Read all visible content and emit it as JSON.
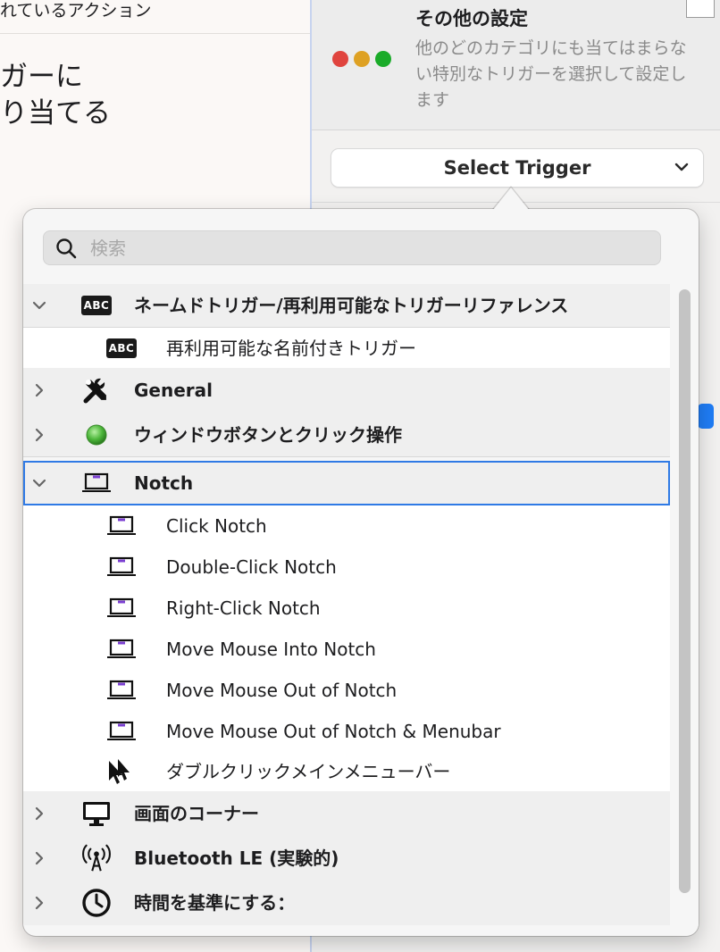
{
  "background": {
    "left_header": "れているアクション",
    "left_big_line1": "ガーに",
    "left_big_line2": "り当てる",
    "other_title": "その他の設定",
    "other_desc": "他のどのカテゴリにも当てはまらない特別なトリガーを選択して設定します",
    "select_trigger_label": "Select Trigger"
  },
  "search": {
    "placeholder": "検索"
  },
  "rows": [
    {
      "kind": "group",
      "expanded": true,
      "icon": "abc-icon",
      "label": "ネームドトリガー/再利用可能なトリガーリファレンス"
    },
    {
      "kind": "item",
      "icon": "abc-icon",
      "label": "再利用可能な名前付きトリガー"
    },
    {
      "kind": "group",
      "expanded": false,
      "icon": "tools-icon",
      "label": "General"
    },
    {
      "kind": "group",
      "expanded": false,
      "icon": "green-button-icon",
      "label": "ウィンドウボタンとクリック操作"
    },
    {
      "kind": "group",
      "expanded": true,
      "selected": true,
      "icon": "laptop-notch-icon",
      "label": "Notch"
    },
    {
      "kind": "item",
      "icon": "laptop-notch-icon",
      "label": "Click Notch"
    },
    {
      "kind": "item",
      "icon": "laptop-notch-icon",
      "label": "Double-Click Notch"
    },
    {
      "kind": "item",
      "icon": "laptop-notch-icon",
      "label": "Right-Click Notch"
    },
    {
      "kind": "item",
      "icon": "laptop-notch-icon",
      "label": "Move Mouse Into Notch"
    },
    {
      "kind": "item",
      "icon": "laptop-notch-icon",
      "label": "Move Mouse Out of Notch"
    },
    {
      "kind": "item",
      "icon": "laptop-notch-icon",
      "label": "Move Mouse Out of Notch & Menubar"
    },
    {
      "kind": "item",
      "icon": "double-cursor-icon",
      "label": "ダブルクリックメインメニューバー"
    },
    {
      "kind": "group",
      "expanded": false,
      "icon": "monitor-icon",
      "label": "画面のコーナー"
    },
    {
      "kind": "group",
      "expanded": false,
      "icon": "antenna-icon",
      "label": "Bluetooth LE (実験的)"
    },
    {
      "kind": "group",
      "expanded": false,
      "icon": "clock-icon",
      "label": "時間を基準にする："
    }
  ],
  "colors": {
    "accent": "#2f7ae5",
    "notch_purple": "#7b3fd1"
  }
}
